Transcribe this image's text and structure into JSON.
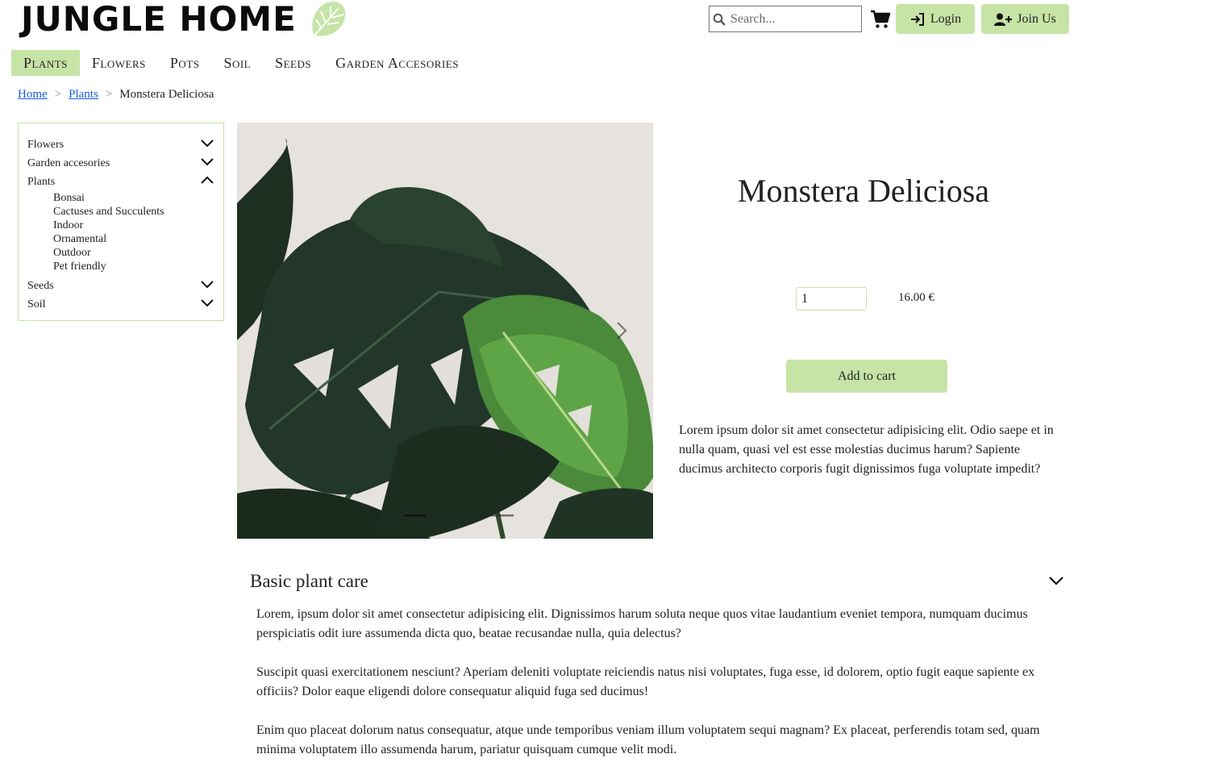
{
  "brand": {
    "name": "JUNGLE HOME",
    "logo_icon": "monstera-leaf-icon",
    "accent_color": "#c6e4a6"
  },
  "header": {
    "search_placeholder": "Search...",
    "cart_icon": "cart-icon",
    "login_label": "Login",
    "join_label": "Join Us"
  },
  "nav": {
    "items": [
      {
        "label": "Plants",
        "active": true
      },
      {
        "label": "Flowers"
      },
      {
        "label": "Pots"
      },
      {
        "label": "Soil"
      },
      {
        "label": "Seeds"
      },
      {
        "label": "Garden Accesories"
      }
    ]
  },
  "breadcrumb": {
    "home": "Home",
    "section": "Plants",
    "current": "Monstera Deliciosa",
    "separator": ">"
  },
  "sidebar": {
    "categories": [
      {
        "label": "Flowers",
        "expanded": false
      },
      {
        "label": "Garden accesories",
        "expanded": false
      },
      {
        "label": "Plants",
        "expanded": true,
        "subcategories": [
          "Bonsai",
          "Cactuses and Succulents",
          "Indoor",
          "Ornamental",
          "Outdoor",
          "Pet friendly"
        ]
      },
      {
        "label": "Seeds",
        "expanded": false
      },
      {
        "label": "Soil",
        "expanded": false
      }
    ]
  },
  "carousel": {
    "slide_count": 5,
    "active_slide": 2
  },
  "product": {
    "title": "Monstera Deliciosa",
    "quantity": "1",
    "price": "16.00 €",
    "add_to_cart": "Add to cart",
    "description": "Lorem ipsum dolor sit amet consectetur adipisicing elit. Odio saepe et in nulla quam, quasi vel est esse molestias ducimus harum? Sapiente ducimus architecto corporis fugit dignissimos fuga voluptate impedit?"
  },
  "care": {
    "heading": "Basic plant care",
    "paragraphs": [
      "Lorem, ipsum dolor sit amet consectetur adipisicing elit. Dignissimos harum soluta neque quos vitae laudantium eveniet tempora, numquam ducimus perspiciatis odit iure assumenda dicta quo, beatae recusandae nulla, quia delectus?",
      "Suscipit quasi exercitationem nesciunt? Aperiam deleniti voluptate reiciendis natus nisi voluptates, fuga esse, id dolorem, optio fugit eaque sapiente ex officiis? Dolor eaque eligendi dolore consequatur aliquid fuga sed ducimus!",
      "Enim quo placeat dolorum natus consequatur, atque unde temporibus veniam illum voluptatem sequi magnam? Ex placeat, perferendis totam sed, quam minima voluptatem illo assumenda harum, pariatur quisquam cumque velit modi."
    ]
  }
}
